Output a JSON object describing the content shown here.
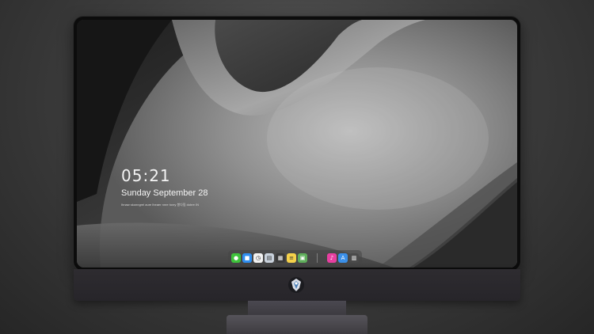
{
  "lock_screen": {
    "time": "05:21",
    "date": "Sunday September  28",
    "subline": "Ihnaw skonngrei aure lheaer nnre toxry 봉다림 dobre IN"
  },
  "dock": {
    "items": [
      {
        "name": "messages-icon",
        "glyph": "●",
        "color": "#3ec23b"
      },
      {
        "name": "finder-icon",
        "glyph": "■",
        "color": "#2f8ef0"
      },
      {
        "name": "clock-icon",
        "glyph": "◷",
        "color": "#f2f2f2"
      },
      {
        "name": "preview-icon",
        "glyph": "▤",
        "color": "#c9d2dc"
      },
      {
        "name": "final-cut-icon",
        "glyph": "▦",
        "color": "#3a3a3a"
      },
      {
        "name": "notes-icon",
        "glyph": "≡",
        "color": "#f5d14a"
      },
      {
        "name": "photos-icon",
        "glyph": "▣",
        "color": "#5fae5b"
      },
      {
        "name": "music-icon",
        "glyph": "♪",
        "color": "#e73fa0"
      },
      {
        "name": "app-store-icon",
        "glyph": "A",
        "color": "#3a8fe8"
      },
      {
        "name": "trash-icon",
        "glyph": "▥",
        "color": "#4a4a4a"
      }
    ]
  }
}
